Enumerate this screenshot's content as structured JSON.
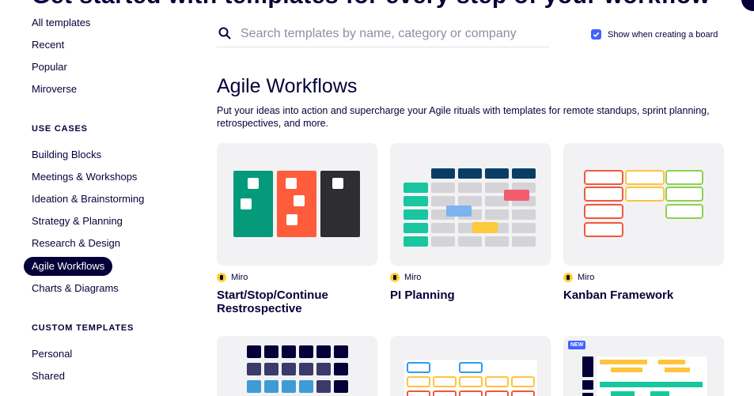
{
  "header": {
    "clipped_title": "Get started with templates for every step of your workflow"
  },
  "sidebar": {
    "items": [
      {
        "label": "All templates"
      },
      {
        "label": "Recent"
      },
      {
        "label": "Popular"
      },
      {
        "label": "Miroverse"
      }
    ],
    "use_cases_heading": "USE CASES",
    "use_cases": [
      {
        "label": "Building Blocks"
      },
      {
        "label": "Meetings & Workshops"
      },
      {
        "label": "Ideation & Brainstorming"
      },
      {
        "label": "Strategy & Planning"
      },
      {
        "label": "Research & Design"
      },
      {
        "label": "Agile Workflows",
        "active": true
      },
      {
        "label": "Charts & Diagrams"
      }
    ],
    "custom_heading": "CUSTOM TEMPLATES",
    "custom": [
      {
        "label": "Personal"
      },
      {
        "label": "Shared"
      }
    ]
  },
  "search": {
    "placeholder": "Search templates by name, category or company",
    "icon": "search-icon"
  },
  "show_toggle": {
    "label": "Show when creating a board",
    "checked": true
  },
  "section": {
    "title": "Agile Workflows",
    "description": "Put your ideas into action and supercharge your Agile rituals with templates for remote standups, sprint planning, retrospectives, and more."
  },
  "cards": [
    {
      "author": "Miro",
      "title": "Start/Stop/Continue Restrospective"
    },
    {
      "author": "Miro",
      "title": "PI Planning"
    },
    {
      "author": "Miro",
      "title": "Kanban Framework"
    }
  ],
  "badges": {
    "new": "NEW"
  },
  "colors": {
    "primary": "#050038",
    "accent": "#4262ff",
    "miro_yellow": "#ffd02f",
    "card_bg": "#f2f2f4"
  }
}
